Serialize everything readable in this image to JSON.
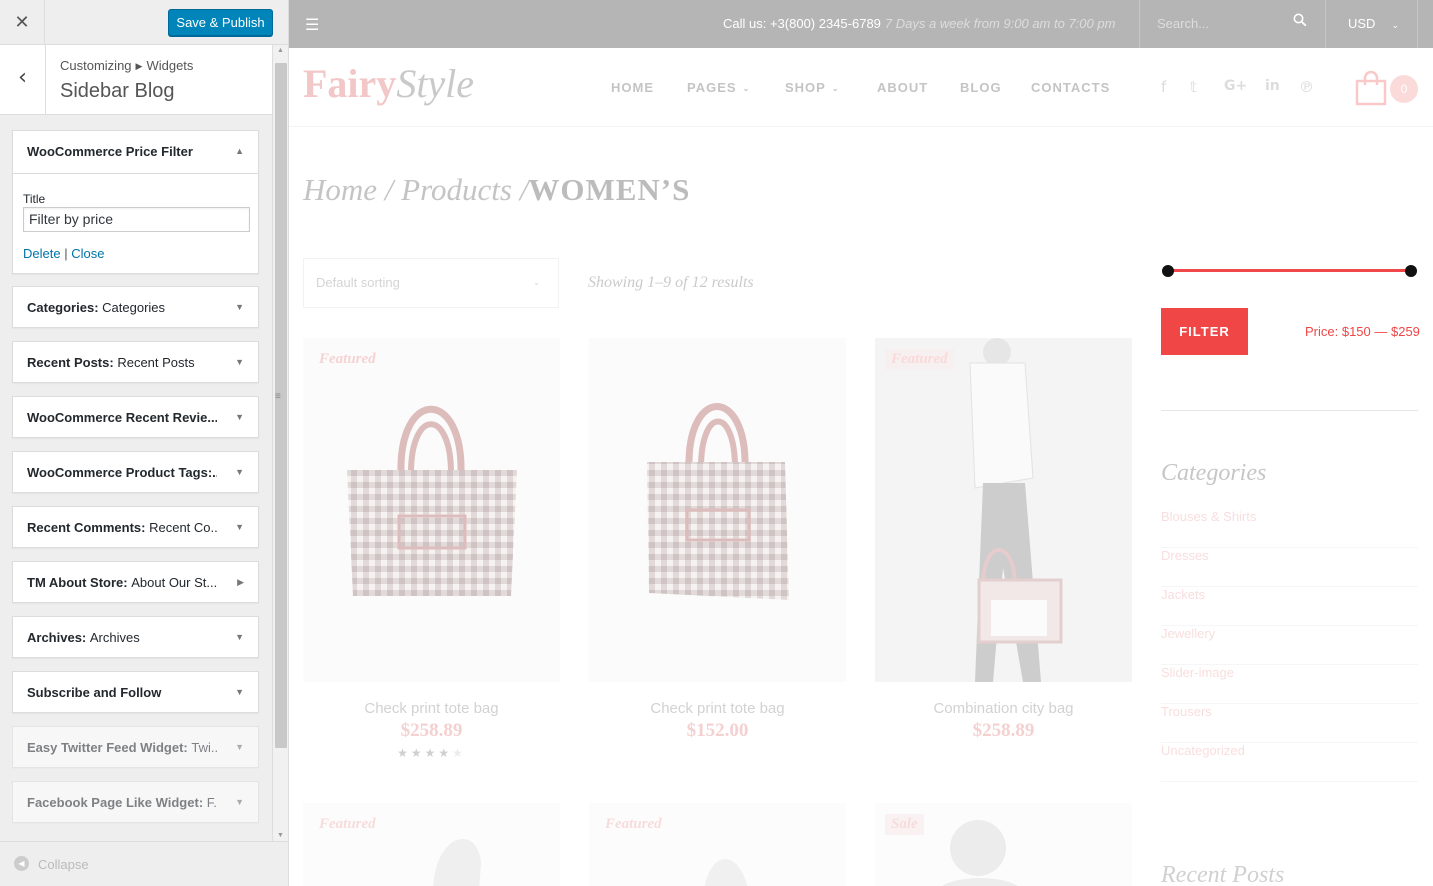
{
  "customizer": {
    "close_icon": "close-icon",
    "publish_label": "Save & Publish",
    "breadcrumb": {
      "parent": "Customizing",
      "child": "Widgets"
    },
    "section_title": "Sidebar Blog",
    "open_widget": {
      "title": "WooCommerce Price Filter",
      "field_label": "Title",
      "field_value": "Filter by price",
      "delete_label": "Delete",
      "separator": "|",
      "close_label": "Close"
    },
    "widgets": [
      {
        "name": "Categories",
        "subtitle": "Categories"
      },
      {
        "name": "Recent Posts",
        "subtitle": "Recent Posts"
      },
      {
        "name": "WooCommerce Recent Revie...",
        "subtitle": ""
      },
      {
        "name": "WooCommerce Product Tags:...",
        "subtitle": ""
      },
      {
        "name": "Recent Comments",
        "subtitle": "Recent Co..."
      },
      {
        "name": "TM About Store",
        "subtitle": "About Our St..."
      },
      {
        "name": "Archives",
        "subtitle": "Archives"
      },
      {
        "name": "Subscribe and Follow",
        "subtitle": ""
      },
      {
        "name": "Easy Twitter Feed Widget",
        "subtitle": "Twi..."
      },
      {
        "name": "Facebook Page Like Widget",
        "subtitle": "F..."
      }
    ],
    "collapse_label": "Collapse"
  },
  "site": {
    "topbar": {
      "call": "Call us: +3(800) 2345-6789",
      "hours": "7 Days a week from 9:00 am to 7:00 pm",
      "search_placeholder": "Search...",
      "currency": "USD"
    },
    "logo": {
      "part1": "Fairy",
      "part2": "Style"
    },
    "nav": [
      "HOME",
      "PAGES",
      "SHOP",
      "ABOUT",
      "BLOG",
      "CONTACTS"
    ],
    "social_icons": [
      "facebook-icon",
      "twitter-icon",
      "google-plus-icon",
      "linkedin-icon",
      "pinterest-icon"
    ],
    "cart_count": "0",
    "breadcrumb": {
      "home": "Home",
      "sep": "/",
      "products": "Products",
      "current": "WOMEN’S"
    },
    "sorting": "Default sorting",
    "showing": "Showing 1–9 of 12 results",
    "products": [
      {
        "badge": "Featured",
        "name": "Check print tote bag",
        "price": "$258.89",
        "rating": 4,
        "max": 5
      },
      {
        "badge": "",
        "name": "Check print tote bag",
        "price": "$152.00"
      },
      {
        "badge": "Featured",
        "name": "Combination city bag",
        "price": "$258.89"
      }
    ],
    "row2_badges": [
      "Featured",
      "Featured",
      "Sale"
    ],
    "price_filter": {
      "button": "FILTER",
      "label": "Price: $150 — $259",
      "min": 150,
      "max": 259
    },
    "categories_title": "Categories",
    "categories": [
      "Blouses & Shirts",
      "Dresses",
      "Jackets",
      "Jewellery",
      "Slider-image",
      "Trousers",
      "Uncategorized"
    ],
    "recent_posts_title": "Recent Posts"
  }
}
